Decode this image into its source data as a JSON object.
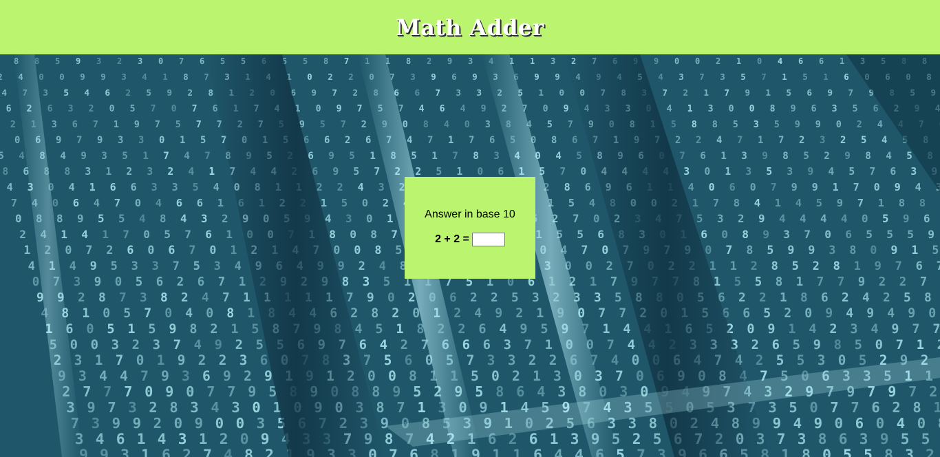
{
  "header": {
    "title": "Math Adder",
    "background_color": "#bbf56f"
  },
  "background": {
    "description_icon": "matrix-digits-background",
    "base_color": "#1c4a5c",
    "digit_color": "#a9e6ef"
  },
  "card": {
    "instruction": "Answer in base 10",
    "equation": "2 + 2 =",
    "answer_value": "",
    "background_color": "#bbf56f"
  }
}
